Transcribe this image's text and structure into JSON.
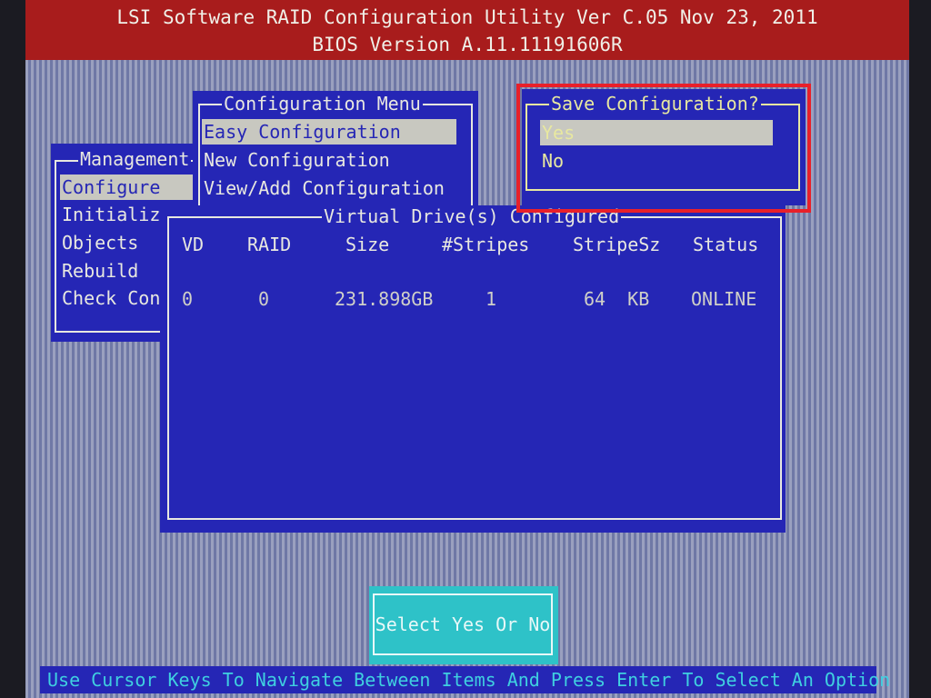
{
  "header": {
    "title_line1": "LSI Software RAID Configuration Utility  Ver C.05 Nov 23, 2011",
    "title_line2": "BIOS Version   A.11.11191606R"
  },
  "management_menu": {
    "title": "Management",
    "items": [
      {
        "label": "Configure",
        "selected": true
      },
      {
        "label": "Initializ"
      },
      {
        "label": "Objects"
      },
      {
        "label": "Rebuild"
      },
      {
        "label": "Check Con"
      }
    ]
  },
  "configuration_menu": {
    "title": "Configuration Menu",
    "items": [
      {
        "label": "Easy Configuration",
        "selected": true
      },
      {
        "label": "New Configuration"
      },
      {
        "label": "View/Add Configuration"
      }
    ]
  },
  "save_dialog": {
    "title": "Save Configuration?",
    "options": [
      {
        "label": "Yes",
        "selected": true
      },
      {
        "label": "No"
      }
    ]
  },
  "virtual_drives": {
    "title": "Virtual Drive(s) Configured",
    "columns": [
      "VD",
      "RAID",
      "Size",
      "#Stripes",
      "StripeSz",
      "Status"
    ],
    "rows": [
      {
        "vd": "0",
        "raid": "0",
        "size": "231.898GB",
        "stripes": "1",
        "stripe_sz": "64  KB",
        "status": "ONLINE"
      }
    ]
  },
  "hint_box": {
    "text": "Select Yes Or No"
  },
  "status_bar": {
    "text": "Use Cursor Keys To Navigate Between Items And Press Enter To Select An Option"
  },
  "colors": {
    "panel_blue": "#2526b5",
    "title_red": "#a81c1c",
    "hint_cyan": "#2ec2c8",
    "highlight_red": "#e8202a"
  }
}
